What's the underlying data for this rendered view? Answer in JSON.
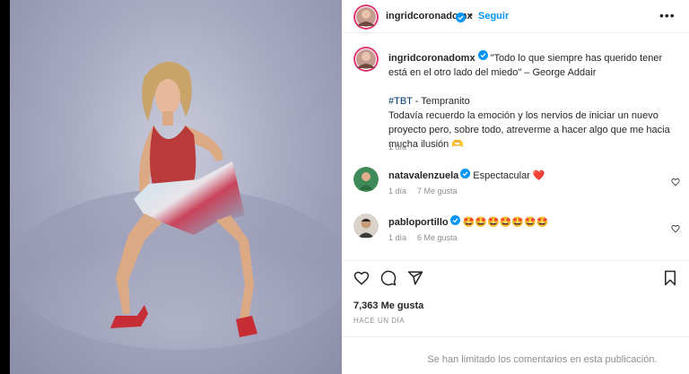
{
  "post": {
    "username": "ingridcoronadomx",
    "follow_label": "Seguir",
    "separator": "•",
    "more_label": "•••"
  },
  "caption": {
    "username": "ingridcoronadomx",
    "quote": "\"Todo lo que siempre has querido tener está en el otro lado del miedo\" – George Addair",
    "hashtag": "#TBT",
    "hashtag_suffix": " - Tempranito",
    "body": "Todavía recuerdo la emoción y los nervios de iniciar un nuevo proyecto pero, sobre todo, atreverme a hacer algo que me hacia mucha ilusión 🫶",
    "time": "1 día"
  },
  "comments": [
    {
      "username": "natavalenzuela",
      "text": "Espectacular ❤️",
      "time": "1 día",
      "likes": "7 Me gusta"
    },
    {
      "username": "pabloportillo",
      "text": "🤩🤩🤩🤩🤩🤩🤩",
      "time": "1 día",
      "likes": "6 Me gusta"
    }
  ],
  "likes_count": "7,363 Me gusta",
  "time_ago": "HACE UN DÍA",
  "comments_limited": "Se han limitado los comentarios en esta publicación.",
  "colors": {
    "accent": "#0095f6",
    "verified": "#0095f6",
    "muted": "#8e8e8e",
    "text": "#262626",
    "hashtag": "#00376b"
  }
}
